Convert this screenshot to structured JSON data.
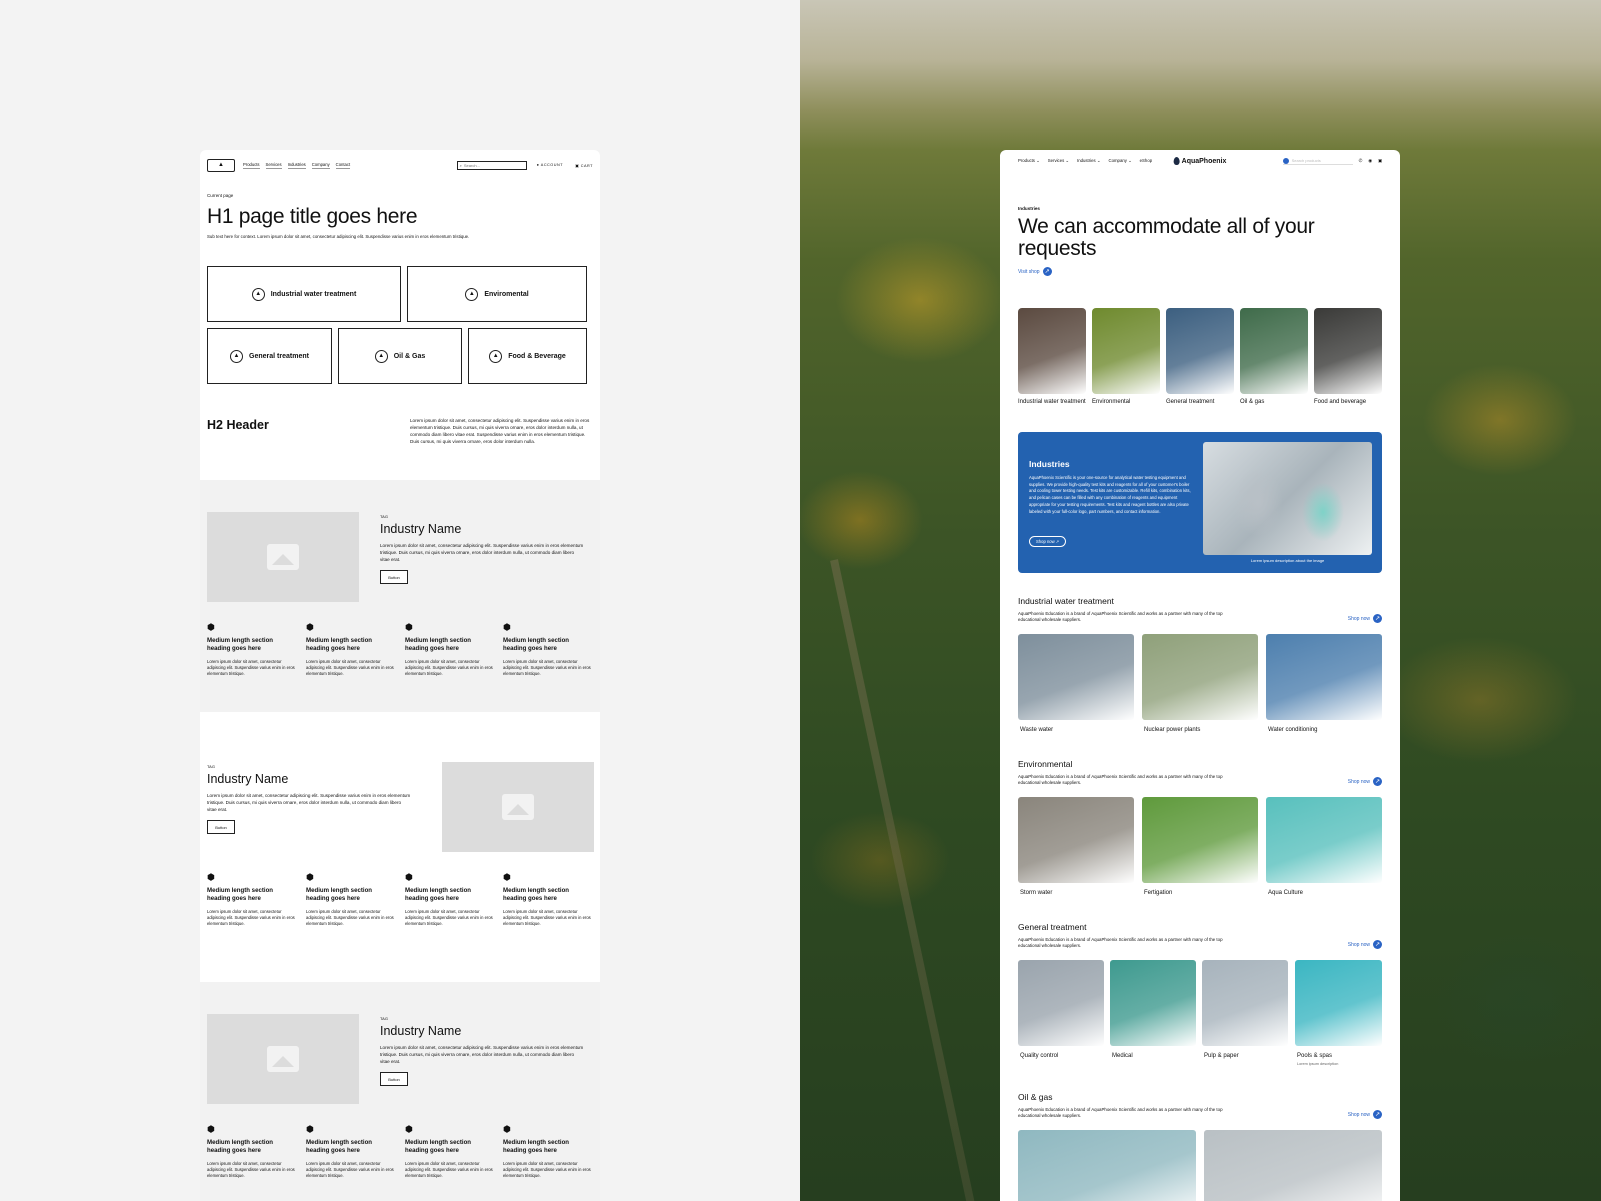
{
  "wireframe": {
    "nav": {
      "links": [
        "Products",
        "Services",
        "Industries",
        "Company",
        "Contact"
      ],
      "search_placeholder": "Search...",
      "account": "ACCOUNT",
      "cart": "CART"
    },
    "breadcrumb": "Current page",
    "h1": "H1 page title goes here",
    "subtitle": "Sub text here for context. Lorem ipsum dolor sit amet, consectetur adipiscing elit. Suspendisse varius enim in eros elementum tristique.",
    "cards": [
      "Industrial water treatment",
      "Enviromental",
      "General treatment",
      "Oil & Gas",
      "Food & Beverage"
    ],
    "h2": "H2 Header",
    "h2_paragraph": "Lorem ipsum dolor sit amet, consectetur adipiscing elit. Suspendisse varius enim in eros elementum tristique. Duis cursus, mi quis viverra ornare, eros dolor interdum nulla, ut commodo diam libero vitae erat. Suspendisse varius enim in eros elementum tristique. Duis cursus, mi quis viverra ornare, eros dolor interdum nulla.",
    "industry": {
      "tag": "TAG",
      "name": "Industry Name",
      "text": "Lorem ipsum dolor sit amet, consectetur adipiscing elit. Suspendisse varius enim in eros elementum tristique. Duis cursus, mi quis viverra ornare, eros dolor interdum nulla, ut commodo diam libero vitae erat.",
      "button": "Button"
    },
    "feature": {
      "heading": "Medium length section heading goes here",
      "text": "Lorem ipsum dolor sit amet, consectetur adipiscing elit. Suspendisse varius enim in eros elementum tristique."
    }
  },
  "site": {
    "nav": {
      "links": [
        "Products ⌄",
        "Services ⌄",
        "Industries ⌄",
        "Company ⌄",
        "eShop"
      ],
      "brand": "AquaPhoenix",
      "search_placeholder": "Search products"
    },
    "eyebrow": "Industries",
    "h1": "We can accommodate all of your requests",
    "visit": "Visit shop",
    "tiles": [
      {
        "label": "Industrial water treatment",
        "color": "#5b4a40"
      },
      {
        "label": "Environmental",
        "color": "#6f8a2e"
      },
      {
        "label": "General treatment",
        "color": "#3c5f80"
      },
      {
        "label": "Oil & gas",
        "color": "#3f6b4a"
      },
      {
        "label": "Food and beverage",
        "color": "#3a3a38"
      }
    ],
    "promo": {
      "title": "Industries",
      "text": "AquaPhoenix Scientific is your one-source for analytical water testing equipment and supplies. We provide high-quality test kits and reagents for all of your customer's boiler and cooling tower testing needs. Test kits are customizable. Refill kits, combination kits, and pelican cases can be filled with any combination of reagents and equipment appropriate for your testing requirements. Test kits and reagent bottles are also private labeled with your full-color logo, part numbers, and contact information.",
      "button": "Shop now ↗",
      "caption": "Lorem ipsum description about the image"
    },
    "groups": [
      {
        "title": "Industrial water treatment",
        "desc": "AquaPhoenix Education is a brand of AquaPhoenix Scientific and works as a partner with many of the top educational wholesale suppliers.",
        "shop": "Shop now",
        "items": [
          {
            "label": "Waste water",
            "color": "#7e8f9c"
          },
          {
            "label": "Nuclear power plants",
            "color": "#8fa07a"
          },
          {
            "label": "Water conditioning",
            "color": "#4d7fae"
          }
        ]
      },
      {
        "title": "Environmental",
        "desc": "AquaPhoenix Education is a brand of AquaPhoenix Scientific and works as a partner with many of the top educational wholesale suppliers.",
        "shop": "Shop now",
        "items": [
          {
            "label": "Storm water",
            "color": "#8a857c"
          },
          {
            "label": "Fertigation",
            "color": "#5f9a3c"
          },
          {
            "label": "Aqua Culture",
            "color": "#58c0bd"
          }
        ]
      },
      {
        "title": "General treatment",
        "desc": "AquaPhoenix Education is a brand of AquaPhoenix Scientific and works as a partner with many of the top educational wholesale suppliers.",
        "shop": "Shop now",
        "items": [
          {
            "label": "Quality control",
            "color": "#9aa4ad"
          },
          {
            "label": "Medical",
            "color": "#3e9a8f"
          },
          {
            "label": "Pulp & paper",
            "color": "#a7b3bc"
          },
          {
            "label": "Pools & spas",
            "color": "#3bb6c2",
            "sub": "Lorem ipsum description"
          }
        ]
      },
      {
        "title": "Oil & gas",
        "desc": "AquaPhoenix Education is a brand of AquaPhoenix Scientific and works as a partner with many of the top educational wholesale suppliers.",
        "shop": "Shop now",
        "items": [
          {
            "label": "",
            "color": "#8fb8c0"
          },
          {
            "label": "",
            "color": "#b9c0c4"
          }
        ]
      }
    ]
  }
}
